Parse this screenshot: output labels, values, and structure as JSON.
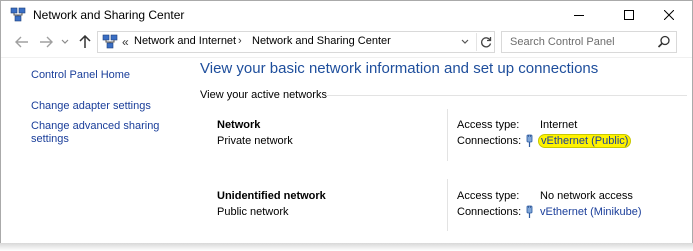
{
  "window": {
    "title": "Network and Sharing Center"
  },
  "navbar": {
    "address_chevrons": "«",
    "breadcrumb": [
      "Network and Internet",
      "Network and Sharing Center"
    ],
    "separator": "›",
    "search_placeholder": "Search Control Panel"
  },
  "sidebar": {
    "links": [
      {
        "label": "Control Panel Home"
      },
      {
        "label": "Change adapter settings"
      },
      {
        "label": "Change advanced sharing\nsettings"
      }
    ]
  },
  "main": {
    "title": "View your basic network information and set up connections",
    "section_label": "View your active networks",
    "networks": [
      {
        "name": "Network",
        "type": "Private network",
        "access_label": "Access type:",
        "access_value": "Internet",
        "connections_label": "Connections:",
        "connection": "vEthernet (Public)",
        "highlighted": true
      },
      {
        "name": "Unidentified network",
        "type": "Public network",
        "access_label": "Access type:",
        "access_value": "No network access",
        "connections_label": "Connections:",
        "connection": "vEthernet (Minikube)",
        "highlighted": false
      }
    ]
  },
  "colors": {
    "link": "#1a3e9a",
    "title": "#1e4e9c",
    "highlight": "#fff200"
  }
}
